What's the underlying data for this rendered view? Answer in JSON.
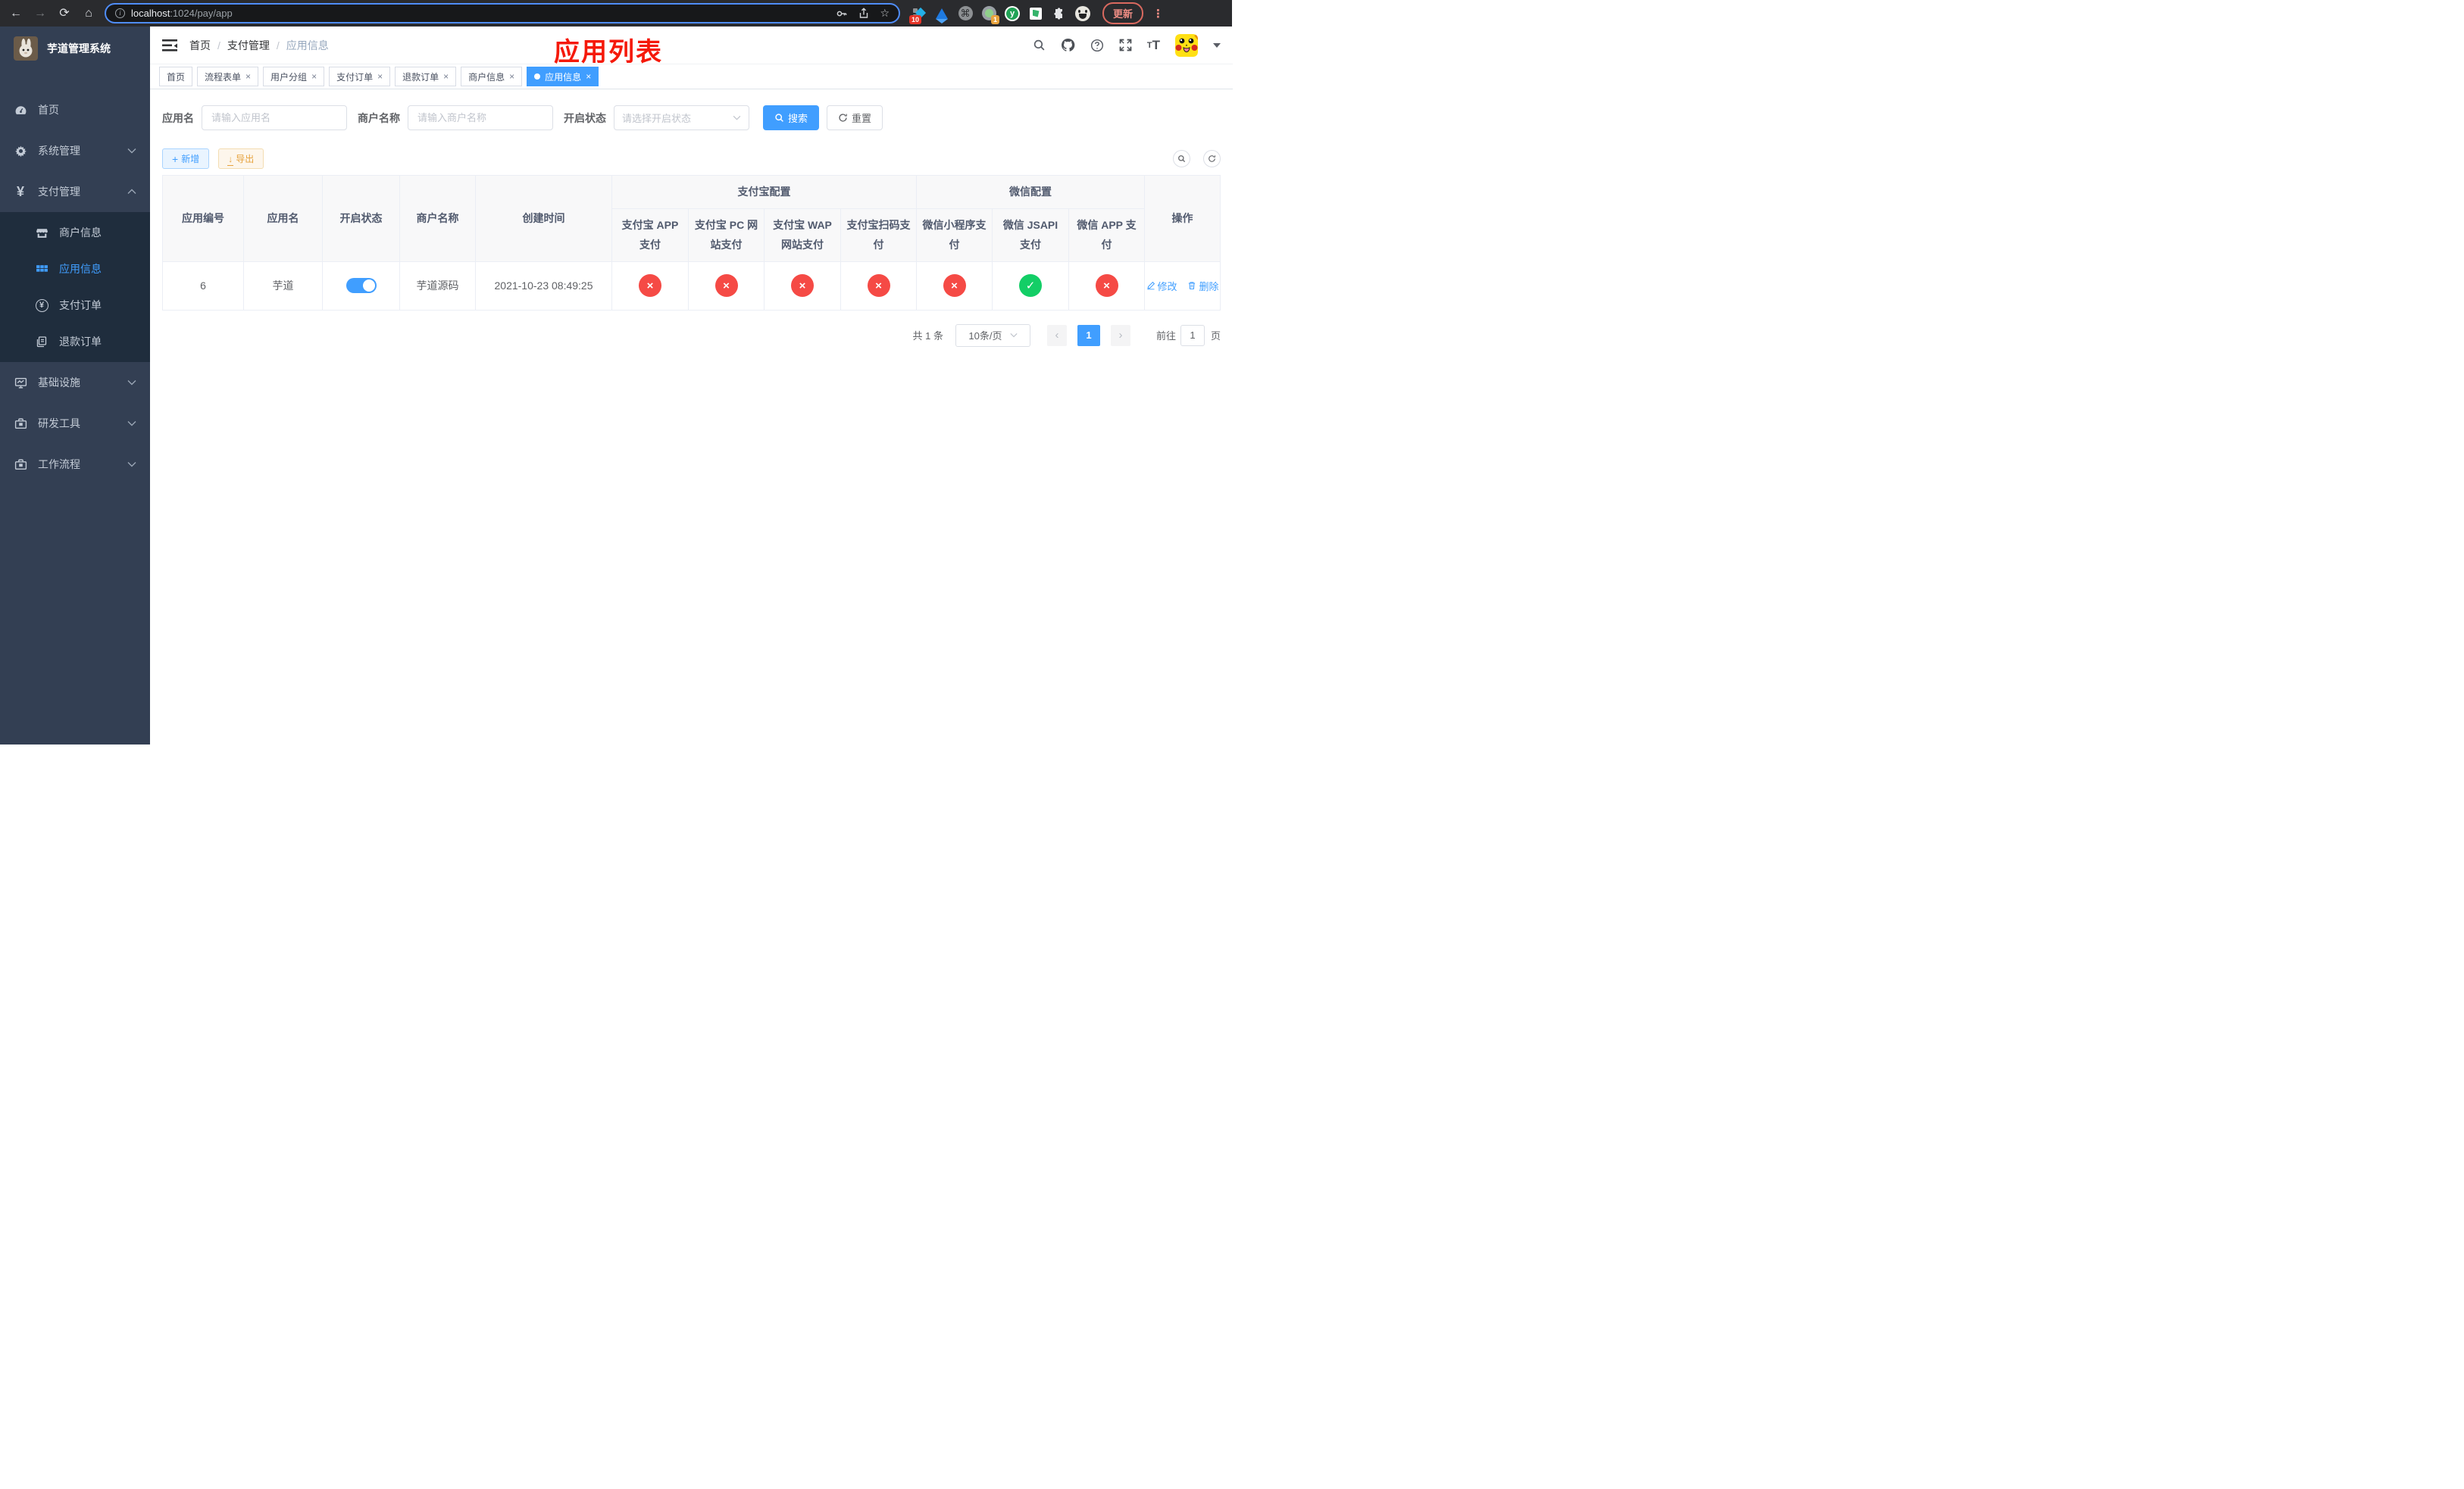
{
  "browser": {
    "url": {
      "domain": "localhost",
      "path": ":1024/pay/app"
    },
    "update_label": "更新",
    "extensions": {
      "blocks_badge": "10",
      "camera_badge": "1",
      "y_letter": "y",
      "command_glyph": "⌘"
    }
  },
  "annotation": {
    "title": "应用列表"
  },
  "sidebar": {
    "title": "芋道管理系统",
    "items": [
      {
        "label": "首页"
      },
      {
        "label": "系统管理"
      },
      {
        "label": "支付管理"
      },
      {
        "label": "商户信息"
      },
      {
        "label": "应用信息"
      },
      {
        "label": "支付订单"
      },
      {
        "label": "退款订单"
      },
      {
        "label": "基础设施"
      },
      {
        "label": "研发工具"
      },
      {
        "label": "工作流程"
      }
    ]
  },
  "breadcrumb": {
    "separator": "/",
    "items": [
      {
        "label": "首页"
      },
      {
        "label": "支付管理"
      },
      {
        "label": "应用信息"
      }
    ]
  },
  "tabs": [
    {
      "label": "首页"
    },
    {
      "label": "流程表单",
      "close": "×"
    },
    {
      "label": "用户分组",
      "close": "×"
    },
    {
      "label": "支付订单",
      "close": "×"
    },
    {
      "label": "退款订单",
      "close": "×"
    },
    {
      "label": "商户信息",
      "close": "×"
    },
    {
      "label": "应用信息",
      "close": "×"
    }
  ],
  "filters": {
    "app_name": {
      "label": "应用名",
      "placeholder": "请输入应用名"
    },
    "merchant_name": {
      "label": "商户名称",
      "placeholder": "请输入商户名称"
    },
    "status": {
      "label": "开启状态",
      "placeholder": "请选择开启状态"
    },
    "search_label": "搜索",
    "reset_label": "重置"
  },
  "toolbar": {
    "add_label": "新增",
    "export_label": "导出"
  },
  "table": {
    "groups": {
      "alipay": "支付宝配置",
      "wechat": "微信配置",
      "action": "操作"
    },
    "columns": [
      "应用编号",
      "应用名",
      "开启状态",
      "商户名称",
      "创建时间",
      "支付宝 APP 支付",
      "支付宝 PC 网站支付",
      "支付宝 WAP 网站支付",
      "支付宝扫码支付",
      "微信小程序支付",
      "微信 JSAPI 支付",
      "微信 APP 支付"
    ],
    "row": {
      "id": "6",
      "name": "芋道",
      "merchant": "芋道源码",
      "created": "2021-10-23 08:49:25",
      "statuses": [
        {
          "name": "alipay-app-pay",
          "state": "disabled",
          "glyph": "×"
        },
        {
          "name": "alipay-pc-pay",
          "state": "disabled",
          "glyph": "×"
        },
        {
          "name": "alipay-wap-pay",
          "state": "disabled",
          "glyph": "×"
        },
        {
          "name": "alipay-qr-pay",
          "state": "disabled",
          "glyph": "×"
        },
        {
          "name": "wechat-mini-pay",
          "state": "disabled",
          "glyph": "×"
        },
        {
          "name": "wechat-jsapi-pay",
          "state": "enabled",
          "glyph": "✓"
        },
        {
          "name": "wechat-app-pay",
          "state": "disabled",
          "glyph": "×"
        }
      ],
      "edit_label": "修改",
      "delete_label": "删除"
    }
  },
  "pagination": {
    "total": "共 1 条",
    "page_size": "10条/页",
    "current_page": "1",
    "goto_label": "前往",
    "goto_value": "1",
    "page_unit": "页"
  },
  "colors": {
    "primary": "#409eff",
    "success": "#13ce66",
    "danger": "#f54a45",
    "warning": "#e6a23c",
    "annotation_red": "#f5190a"
  }
}
